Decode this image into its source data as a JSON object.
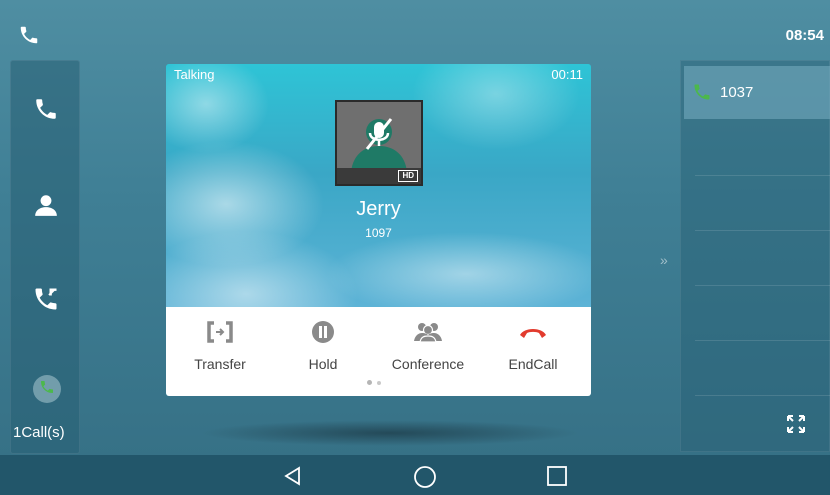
{
  "status_bar": {
    "icon": "phone-icon",
    "time": "08:54"
  },
  "sidebar": {
    "items": [
      {
        "name": "dial",
        "icon": "phone-icon"
      },
      {
        "name": "contacts",
        "icon": "contacts-icon"
      },
      {
        "name": "history",
        "icon": "call-history-icon"
      }
    ],
    "calls_label": "1Call(s)"
  },
  "call": {
    "status": "Talking",
    "timer": "00:11",
    "caller_name": "Jerry",
    "caller_number": "1097",
    "hd_badge": "HD",
    "actions": [
      {
        "label": "Transfer",
        "icon": "transfer-icon"
      },
      {
        "label": "Hold",
        "icon": "hold-icon"
      },
      {
        "label": "Conference",
        "icon": "conference-icon"
      },
      {
        "label": "EndCall",
        "icon": "end-call-icon"
      }
    ],
    "page_indicator": {
      "pages": 2,
      "current": 1
    }
  },
  "right_panel": {
    "line_label": "1037",
    "line_icon": "phone-icon"
  },
  "nav": {
    "items": [
      "back-icon",
      "home-icon",
      "recents-icon"
    ]
  },
  "colors": {
    "accent_green": "#4cb84c",
    "end_call_red": "#e23b2e",
    "action_gray": "#8a8a8a"
  }
}
